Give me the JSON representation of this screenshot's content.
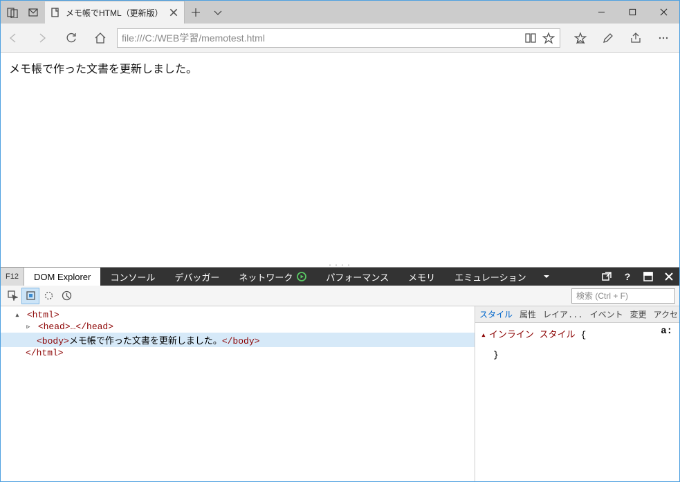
{
  "tab": {
    "title": "メモ帳でHTML（更新版）"
  },
  "address": {
    "url": "file:///C:/WEB学習/memotest.html"
  },
  "page": {
    "body_text": "メモ帳で作った文書を更新しました。"
  },
  "devtools": {
    "f12_label": "F12",
    "tabs": {
      "dom": "DOM Explorer",
      "console": "コンソール",
      "debugger": "デバッガー",
      "network": "ネットワーク",
      "performance": "パフォーマンス",
      "memory": "メモリ",
      "emulation": "エミュレーション"
    },
    "help_label": "?",
    "search_placeholder": "検索 (Ctrl + F)",
    "dom": {
      "html_open": "<html>",
      "head": "<head>…</head>",
      "body_open": "<body>",
      "body_text": "メモ帳で作った文書を更新しました。",
      "body_close": "</body>",
      "html_close": "</html>"
    },
    "styles": {
      "tabs": {
        "style": "スタイル",
        "attr": "属性",
        "layout": "レイア...",
        "event": "イベント",
        "changes": "変更",
        "access": "アクセ..."
      },
      "inline_label": "インライン スタイル",
      "brace_open": "{",
      "brace_close": "}",
      "a_label": "a:"
    }
  }
}
